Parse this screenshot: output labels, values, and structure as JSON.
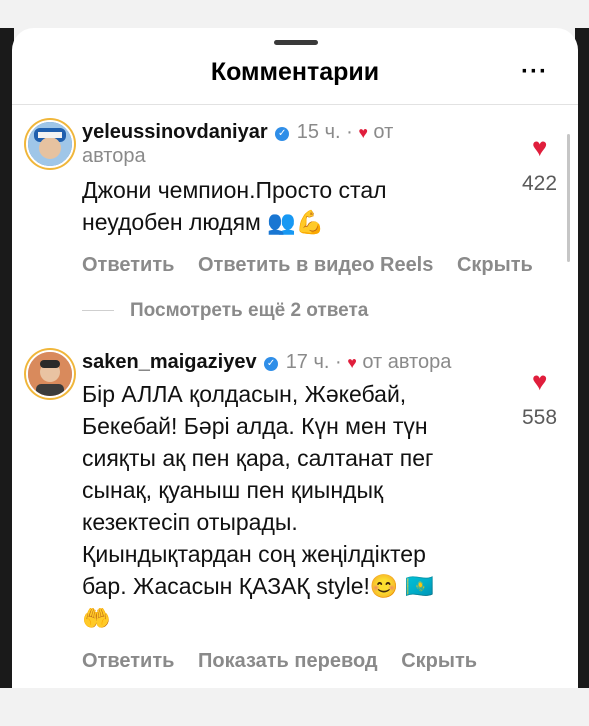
{
  "header": {
    "title": "Комментарии",
    "more_label": "···"
  },
  "comments": [
    {
      "username": "yeleussinovdaniyar",
      "time": "15 ч.",
      "separator": "·",
      "heart": "♥",
      "author_label_first": "от",
      "author_label_second": "автора",
      "text_line1": "Джони чемпион.Просто стал",
      "text_line2": "неудобен людям",
      "emoji1": "👥",
      "emoji2": "💪",
      "likes": "422",
      "actions": [
        "Ответить",
        "Ответить в видео Reels",
        "Скрыть"
      ]
    },
    {
      "username": "saken_maigaziyev",
      "time": "17 ч.",
      "separator": "·",
      "heart": "♥",
      "author_label": "от автора",
      "text_lines": [
        "Бір АЛЛА қолдасын, Жәкебай,",
        "Бекебай! Бәрі алда. Күн мен түн",
        "сияқты ақ пен қара, салтанат пег",
        "сынақ, қуаныш пен қиындық",
        "кезектесіп отырады.",
        "Қиындықтардан соң жеңілдіктер",
        "бар. Жасасын ҚАЗАҚ  style!"
      ],
      "emoji_smile": "😊",
      "emoji_flag": "🇰🇿",
      "emoji_hands": "🤲",
      "likes": "558",
      "actions": [
        "Ответить",
        "Показать перевод",
        "Скрыть"
      ]
    }
  ],
  "replies_toggle": "Посмотреть ещё 2 ответа"
}
